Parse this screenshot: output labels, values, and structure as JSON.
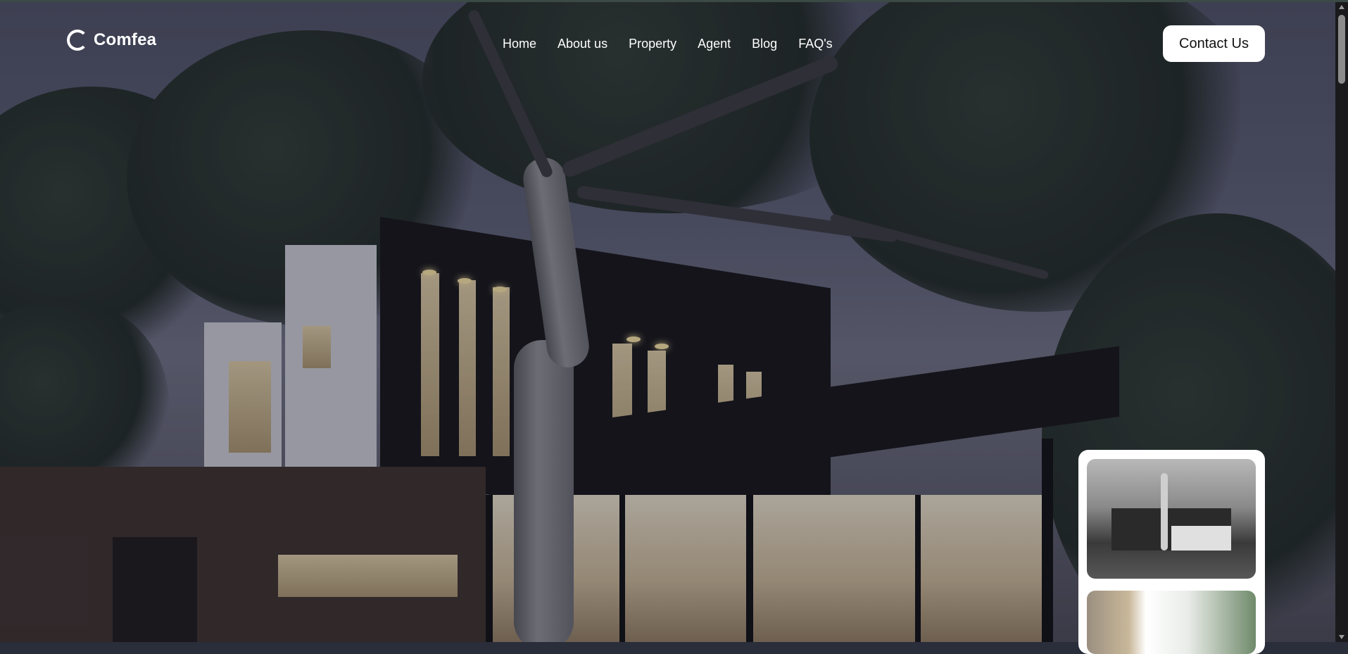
{
  "brand": {
    "name": "Comfea",
    "logo_icon": "comfea-ring-logo-icon"
  },
  "nav": {
    "items": [
      {
        "label": "Home"
      },
      {
        "label": "About us"
      },
      {
        "label": "Property"
      },
      {
        "label": "Agent"
      },
      {
        "label": "Blog"
      },
      {
        "label": "FAQ's"
      }
    ]
  },
  "header": {
    "contact_label": "Contact Us"
  },
  "colors": {
    "text_on_hero": "#ffffff",
    "button_bg": "#ffffff",
    "button_text": "#111111",
    "overlay": "#1a1c30"
  },
  "gallery": {
    "thumbnails": [
      {
        "name": "modern-house-bw-thumbnail"
      },
      {
        "name": "interior-living-room-thumbnail"
      }
    ]
  }
}
